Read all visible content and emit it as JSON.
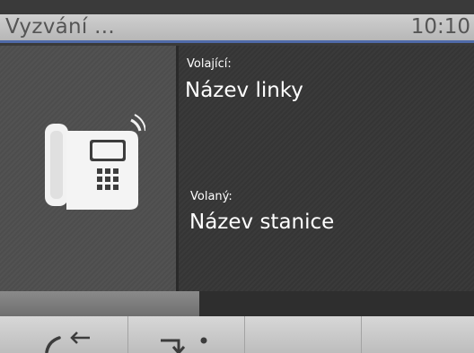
{
  "header": {
    "title": "Vyzvání ...",
    "time": "10:10"
  },
  "call": {
    "caller_label": "Volající:",
    "caller_value": "Název linky",
    "callee_label": "Volaný:",
    "callee_value": "Název stanice",
    "icon": "desk-phone-icon"
  },
  "progress": {
    "fraction": 0.42
  },
  "softkeys": [
    {
      "icon": "call-forward-icon"
    },
    {
      "icon": "call-deflect-icon"
    },
    {
      "icon": "empty"
    },
    {
      "icon": "empty"
    }
  ],
  "colors": {
    "header_accent": "#4f6aa8",
    "panel_dark": "#3a3a3a",
    "text": "#ffffff"
  }
}
